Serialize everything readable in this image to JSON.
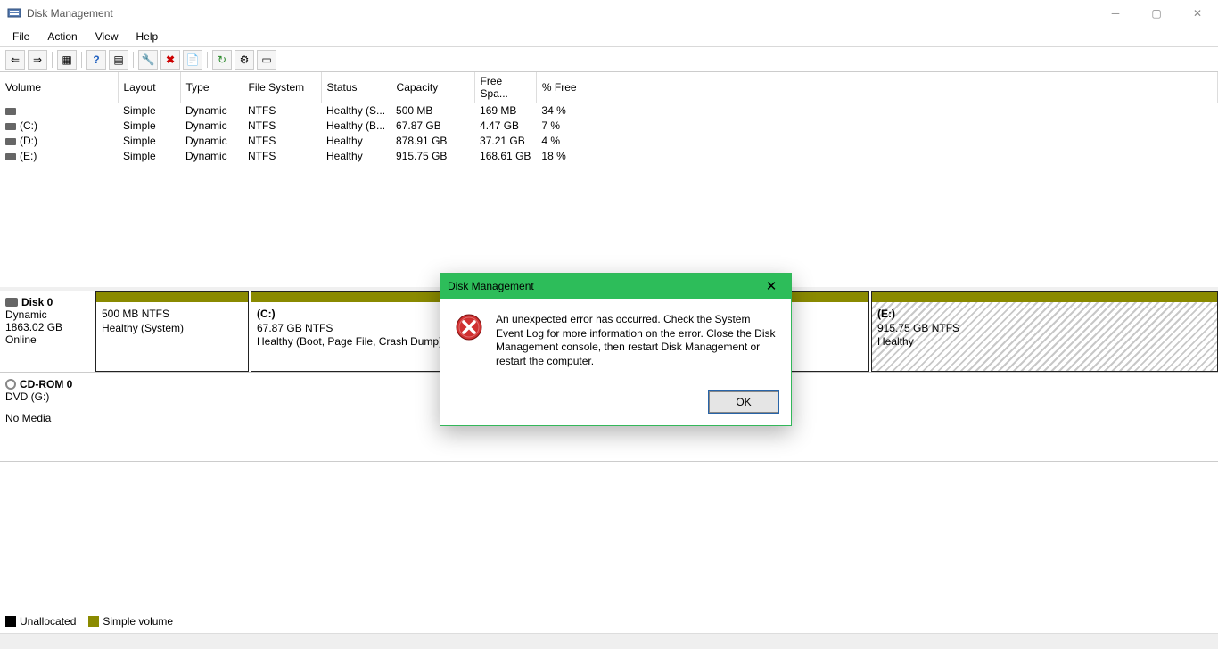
{
  "window": {
    "title": "Disk Management"
  },
  "menu": {
    "file": "File",
    "action": "Action",
    "view": "View",
    "help": "Help"
  },
  "columns": {
    "volume": "Volume",
    "layout": "Layout",
    "type": "Type",
    "fs": "File System",
    "status": "Status",
    "capacity": "Capacity",
    "free": "Free Spa...",
    "pct": "% Free"
  },
  "volumes": [
    {
      "name": "",
      "layout": "Simple",
      "type": "Dynamic",
      "fs": "NTFS",
      "status": "Healthy (S...",
      "capacity": "500 MB",
      "free": "169 MB",
      "pct": "34 %"
    },
    {
      "name": "(C:)",
      "layout": "Simple",
      "type": "Dynamic",
      "fs": "NTFS",
      "status": "Healthy (B...",
      "capacity": "67.87 GB",
      "free": "4.47 GB",
      "pct": "7 %"
    },
    {
      "name": "(D:)",
      "layout": "Simple",
      "type": "Dynamic",
      "fs": "NTFS",
      "status": "Healthy",
      "capacity": "878.91 GB",
      "free": "37.21 GB",
      "pct": "4 %"
    },
    {
      "name": "(E:)",
      "layout": "Simple",
      "type": "Dynamic",
      "fs": "NTFS",
      "status": "Healthy",
      "capacity": "915.75 GB",
      "free": "168.61 GB",
      "pct": "18 %"
    }
  ],
  "disk0": {
    "name": "Disk 0",
    "type": "Dynamic",
    "size": "1863.02 GB",
    "status": "Online",
    "partitions": [
      {
        "title": "",
        "line1": "500 MB NTFS",
        "line2": "Healthy (System)"
      },
      {
        "title": "(C:)",
        "line1": "67.87 GB NTFS",
        "line2": "Healthy (Boot, Page File, Crash Dump)"
      },
      {
        "title": "(E:)",
        "line1": "915.75 GB NTFS",
        "line2": "Healthy"
      }
    ]
  },
  "cdrom": {
    "name": "CD-ROM 0",
    "line1": "DVD (G:)",
    "line2": "No Media"
  },
  "legend": {
    "unallocated": "Unallocated",
    "simple": "Simple volume"
  },
  "dialog": {
    "title": "Disk Management",
    "message": "An unexpected error has occurred. Check the System Event Log for more information on the error. Close the Disk Management console, then restart Disk Management or restart the computer.",
    "ok": "OK"
  }
}
